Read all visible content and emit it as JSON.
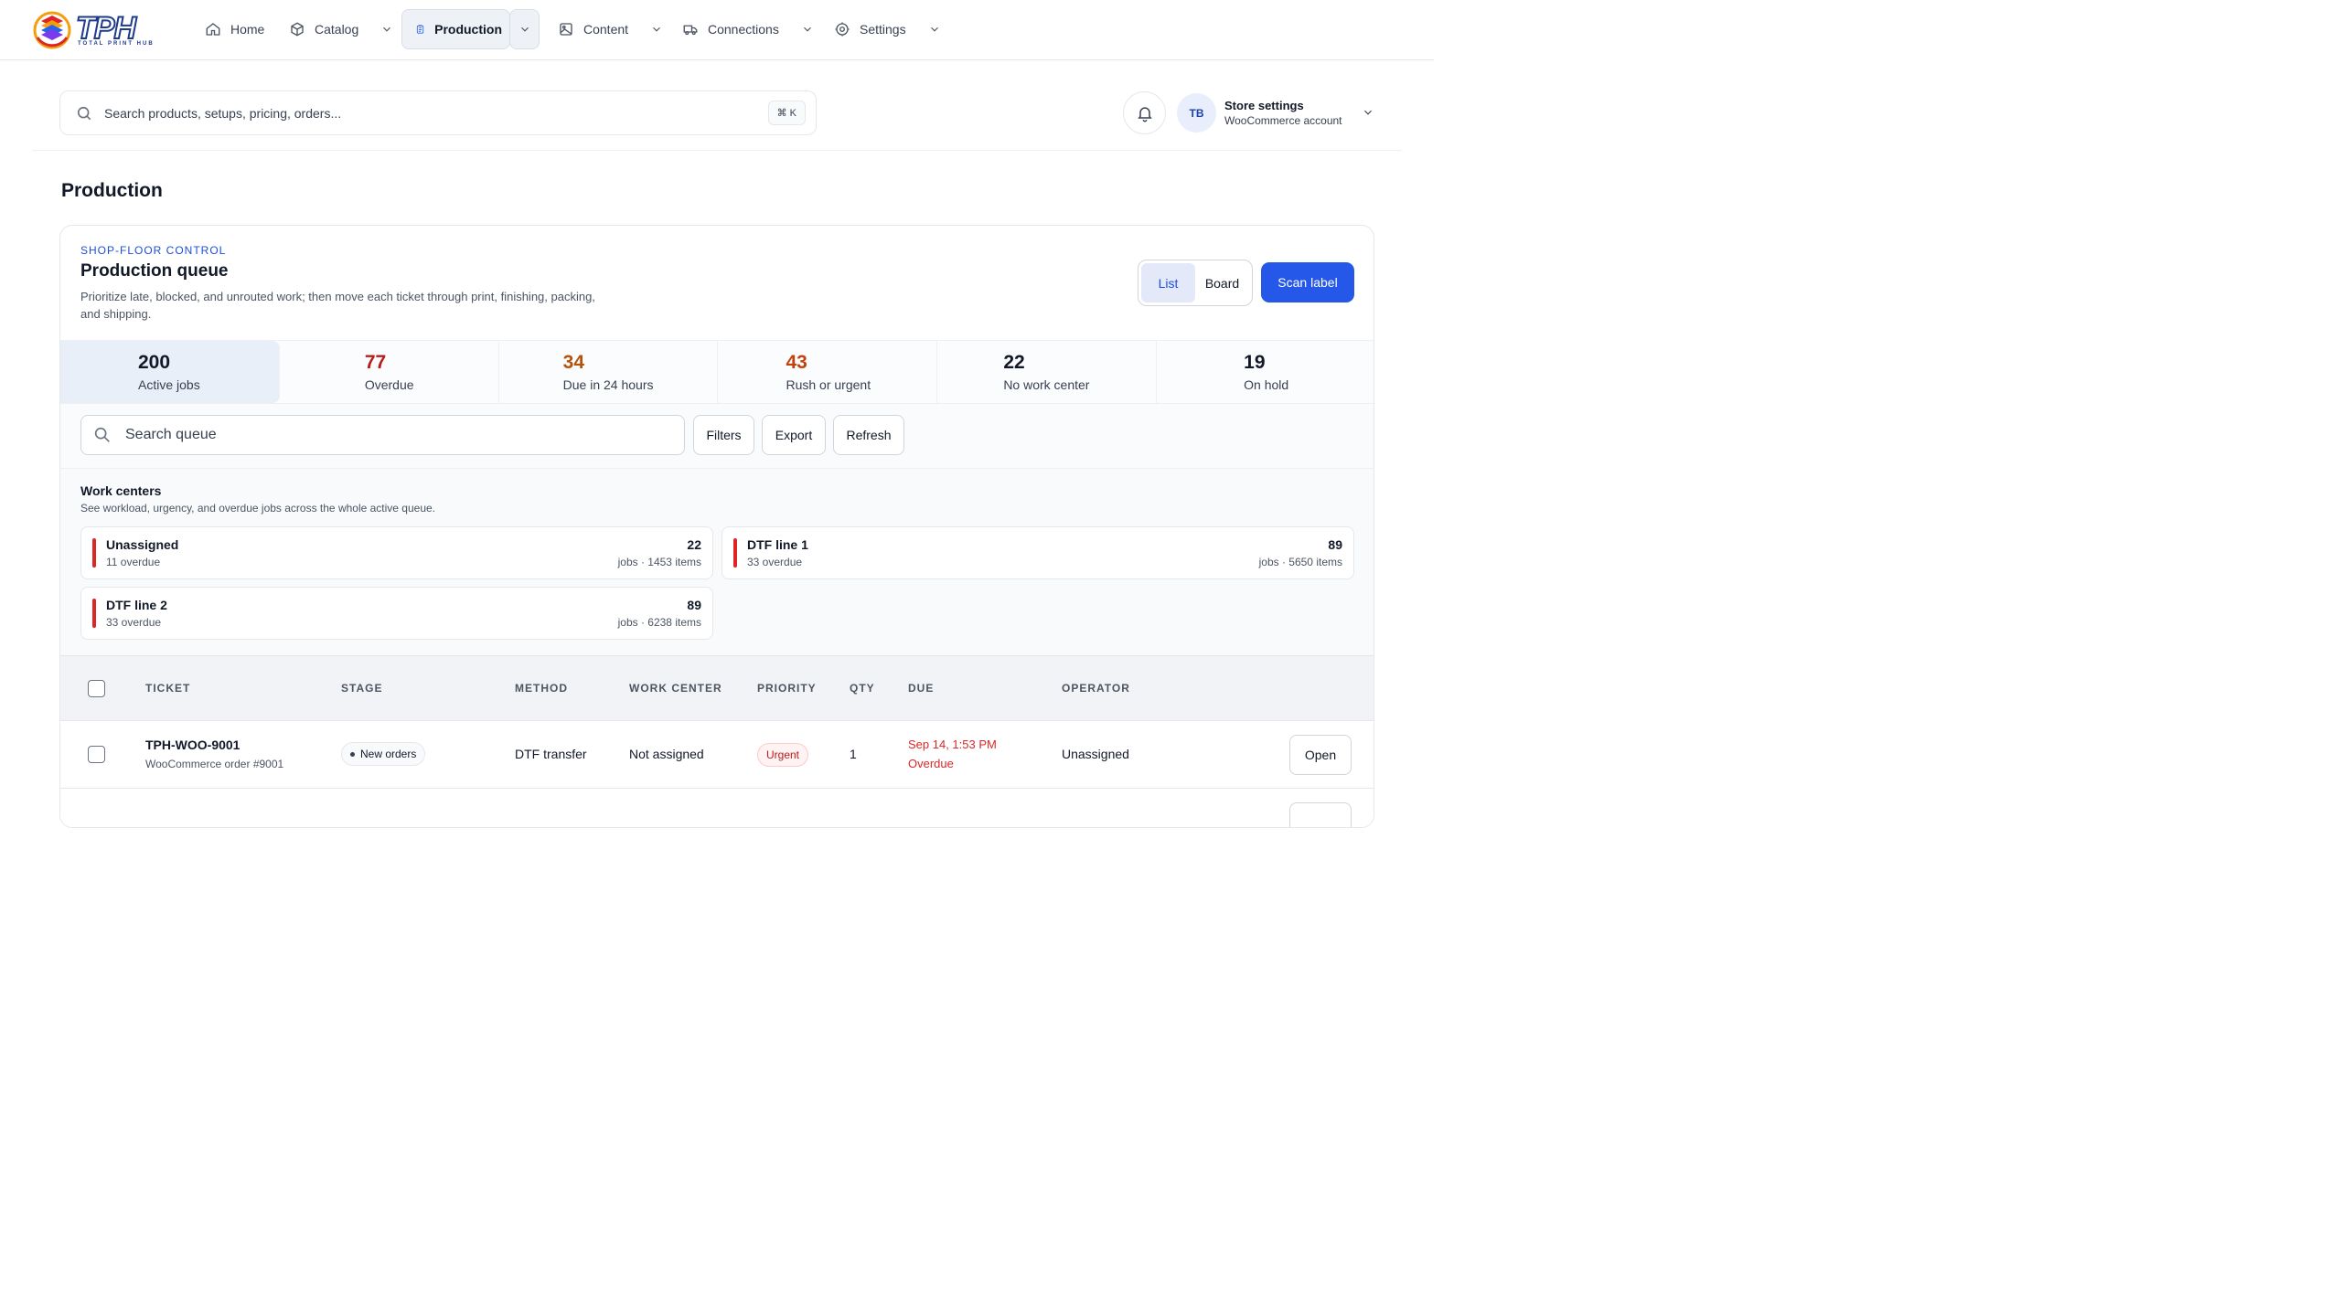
{
  "brand": {
    "logo_text": "TPH",
    "logo_sub": "TOTAL PRINT HUB"
  },
  "nav": {
    "items": [
      {
        "label": "Home",
        "icon": "home-icon"
      },
      {
        "label": "Catalog",
        "icon": "box-icon"
      },
      {
        "label": "Production",
        "icon": "clipboard-icon",
        "active": true
      },
      {
        "label": "Content",
        "icon": "image-icon"
      },
      {
        "label": "Connections",
        "icon": "truck-icon"
      },
      {
        "label": "Settings",
        "icon": "gear-icon"
      }
    ]
  },
  "search": {
    "placeholder": "Search products, setups, pricing, orders...",
    "shortcut": "⌘ K"
  },
  "account": {
    "initials": "TB",
    "title": "Store settings",
    "subtitle": "WooCommerce account"
  },
  "page": {
    "title": "Production"
  },
  "queue": {
    "eyebrow": "SHOP-FLOOR CONTROL",
    "title": "Production queue",
    "description": "Prioritize late, blocked, and unrouted work; then move each ticket through print, finishing, packing, and shipping.",
    "view_list": "List",
    "view_board": "Board",
    "scan_label": "Scan label"
  },
  "stats": [
    {
      "value": "200",
      "label": "Active jobs",
      "color": "#111827"
    },
    {
      "value": "77",
      "label": "Overdue",
      "color": "#b91c1c"
    },
    {
      "value": "34",
      "label": "Due in 24 hours",
      "color": "#b45309"
    },
    {
      "value": "43",
      "label": "Rush or urgent",
      "color": "#c2410c"
    },
    {
      "value": "22",
      "label": "No work center",
      "color": "#111827"
    },
    {
      "value": "19",
      "label": "On hold",
      "color": "#111827"
    }
  ],
  "filters": {
    "search_placeholder": "Search queue",
    "filters": "Filters",
    "export": "Export",
    "refresh": "Refresh"
  },
  "work_centers": {
    "title": "Work centers",
    "subtitle": "See workload, urgency, and overdue jobs across the whole active queue.",
    "items": [
      {
        "name": "Unassigned",
        "overdue": "11 overdue",
        "jobs": "22",
        "meta": "jobs · 1453 items"
      },
      {
        "name": "DTF line 1",
        "overdue": "33 overdue",
        "jobs": "89",
        "meta": "jobs · 5650 items"
      },
      {
        "name": "DTF line 2",
        "overdue": "33 overdue",
        "jobs": "89",
        "meta": "jobs · 6238 items"
      }
    ]
  },
  "table": {
    "columns": [
      "TICKET",
      "STAGE",
      "METHOD",
      "WORK CENTER",
      "PRIORITY",
      "QTY",
      "DUE",
      "OPERATOR"
    ],
    "rows": [
      {
        "ticket": "TPH-WOO-9001",
        "order": "WooCommerce order #9001",
        "stage": "New orders",
        "method": "DTF transfer",
        "work_center": "Not assigned",
        "priority": "Urgent",
        "qty": "1",
        "due": "Sep 14, 1:53 PM",
        "due_status": "Overdue",
        "operator": "Unassigned",
        "action": "Open"
      }
    ]
  }
}
